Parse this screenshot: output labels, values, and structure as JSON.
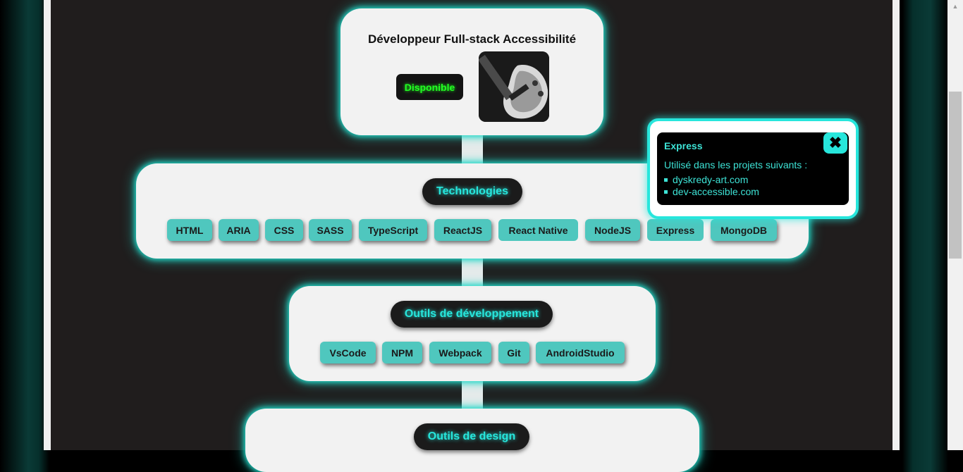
{
  "profile": {
    "job_title": "Développeur Full-stack Accessibilité",
    "status": "Disponible",
    "avatar_icon": "guitar-photo"
  },
  "technologies": {
    "title": "Technologies",
    "items": [
      "HTML",
      "ARIA",
      "CSS",
      "SASS",
      "TypeScript",
      "ReactJS",
      "React Native",
      "NodeJS",
      "Express",
      "MongoDB"
    ]
  },
  "dev_tools": {
    "title": "Outils de développement",
    "items": [
      "VsCode",
      "NPM",
      "Webpack",
      "Git",
      "AndroidStudio"
    ]
  },
  "design_tools": {
    "title": "Outils de design"
  },
  "tooltip": {
    "title": "Express",
    "description": "Utilisé dans les projets suivants :",
    "projects": [
      "dyskredy-art.com",
      "dev-accessible.com"
    ],
    "close_icon": "close-icon"
  },
  "colors": {
    "accent": "#27e6dc",
    "chip": "#4fc7be",
    "available": "#22ff22",
    "background": "#201d1d"
  }
}
